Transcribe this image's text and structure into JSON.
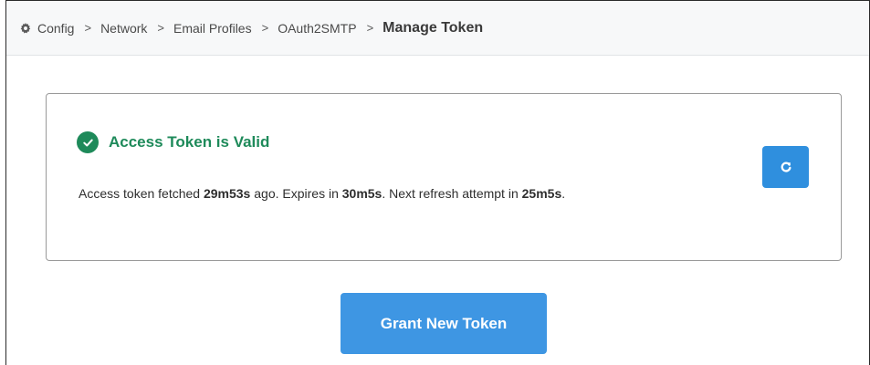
{
  "breadcrumb": {
    "items": [
      {
        "label": "Config",
        "icon": "gear-icon"
      },
      {
        "label": "Network"
      },
      {
        "label": "Email Profiles"
      },
      {
        "label": "OAuth2SMTP"
      }
    ],
    "current": "Manage Token",
    "separator": ">"
  },
  "token_card": {
    "status_icon": "check-circle-icon",
    "status_title": "Access Token is Valid",
    "status_color": "#1e8a5a",
    "details": {
      "prefix": "Access token fetched ",
      "fetched_age": "29m53s",
      "middle1": " ago. Expires in ",
      "expires_in": "30m5s",
      "middle2": ". Next refresh attempt in ",
      "next_refresh": "25m5s",
      "suffix": "."
    },
    "refresh_button_icon": "refresh-icon"
  },
  "actions": {
    "grant_label": "Grant New Token",
    "accent_color": "#3e96e3"
  }
}
